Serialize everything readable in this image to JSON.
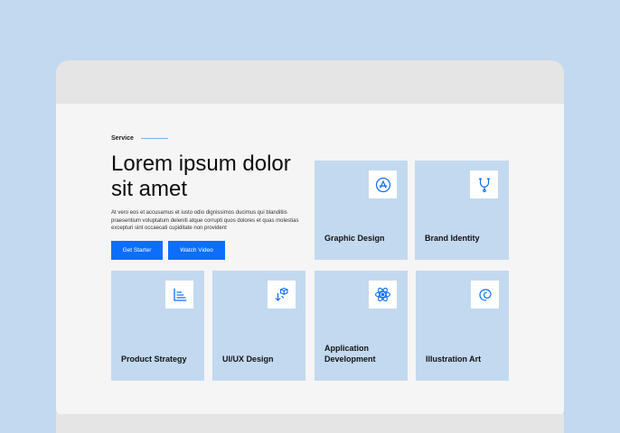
{
  "service": {
    "eyebrow": "Service",
    "headline": "Lorem ipsum dolor sit amet",
    "description": "At vero eos et accusamus et iusto odio dignissimos ducimus qui blanditiis praesentium voluptatum deleniti atque corrupti quos dolores et quas molestias excepturi sint occaecati cupiditate non provident",
    "primary_button": "Get Starter",
    "secondary_button": "Watch Video"
  },
  "cards": [
    {
      "label": "Graphic Design",
      "icon": "app-store-icon"
    },
    {
      "label": "Brand Identity",
      "icon": "stethoscope-icon"
    },
    {
      "label": "Product Strategy",
      "icon": "chart-icon"
    },
    {
      "label": "UI/UX Design",
      "icon": "cube-move-icon"
    },
    {
      "label": "Application Development",
      "icon": "react-icon"
    },
    {
      "label": "Illustration Art",
      "icon": "debian-swirl-icon"
    }
  ],
  "colors": {
    "background": "#c3d9ef",
    "card": "#c3d9ef",
    "accent": "#0d6efd",
    "panel": "#f5f5f5"
  }
}
